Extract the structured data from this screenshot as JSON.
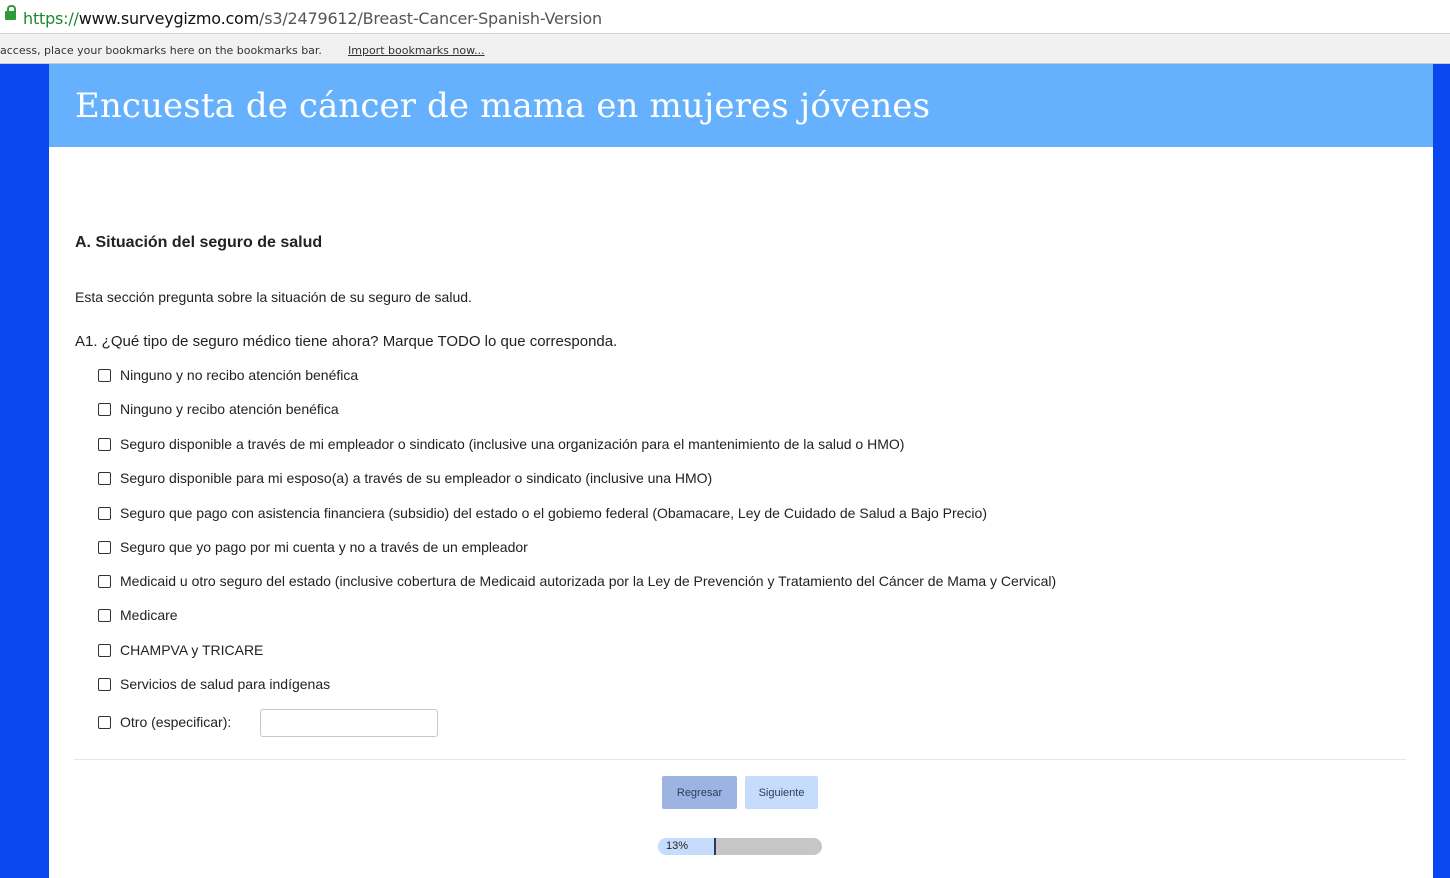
{
  "browser": {
    "url_scheme": "https://",
    "url_host": "www.surveygizmo.com",
    "url_path": "/s3/2479612/Breast-Cancer-Spanish-Version",
    "bookmarks_message": "access, place your bookmarks here on the bookmarks bar.",
    "bookmarks_import": "Import bookmarks now..."
  },
  "survey": {
    "title": "Encuesta de cáncer de mama en mujeres jóvenes",
    "section_heading": "A.  Situación del seguro de salud",
    "section_description": "Esta sección pregunta sobre la situación de su seguro de salud.",
    "question": "A1.  ¿Qué tipo de seguro médico tiene ahora? Marque TODO lo que corresponda.",
    "options": [
      "Ninguno y no recibo atención benéfica",
      "Ninguno y recibo atención benéfica",
      "Seguro disponible a través de mi empleador o sindicato (inclusive una organización para el mantenimiento de la salud o HMO)",
      "Seguro disponible para mi esposo(a) a través de su empleador o sindicato (inclusive una HMO)",
      "Seguro que pago con asistencia financiera (subsidio) del estado o el gobiemo federal (Obamacare, Ley de Cuidado de Salud a Bajo Precio)",
      "Seguro que yo pago por mi cuenta y no a través de un empleador",
      "Medicaid u otro seguro del estado (inclusive cobertura de Medicaid autorizada por la Ley de Prevención y Tratamiento del Cáncer de Mama y Cervical)",
      "Medicare",
      "CHAMPVA y TRICARE",
      "Servicios de salud para indígenas",
      "Otro (especificar):"
    ],
    "other_value": "",
    "back_button": "Regresar",
    "next_button": "Siguiente",
    "progress_label": "13%",
    "progress_fraction": 0.34
  },
  "colors": {
    "banner": "#66b1fd",
    "page_background": "#0a47f0",
    "back_button": "#9db4e3",
    "next_button": "#c6dcfc"
  }
}
